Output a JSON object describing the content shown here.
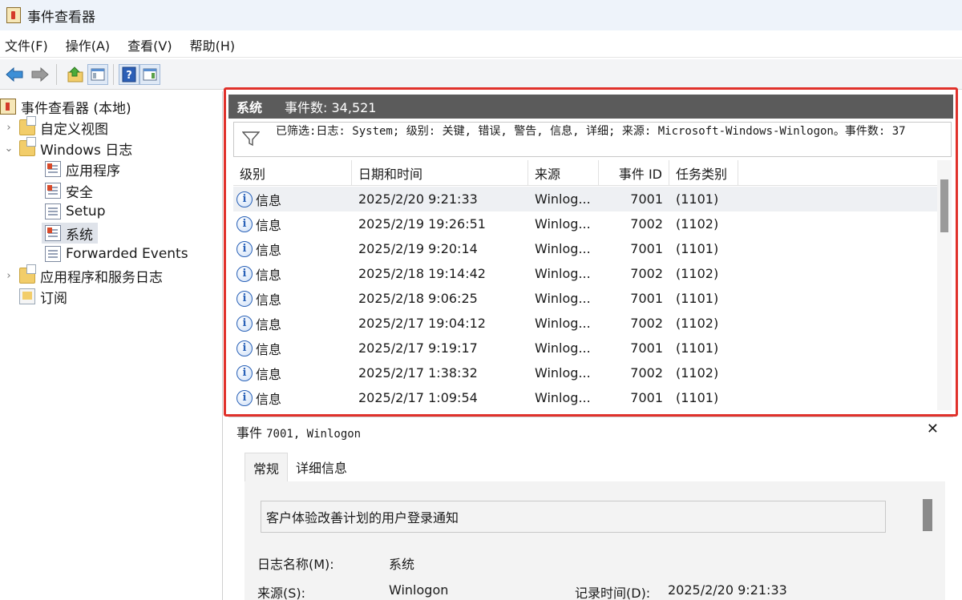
{
  "window": {
    "title": "事件查看器"
  },
  "menu": [
    {
      "label": "文件(F)"
    },
    {
      "label": "操作(A)"
    },
    {
      "label": "查看(V)"
    },
    {
      "label": "帮助(H)"
    }
  ],
  "toolbar": {
    "icons": [
      "back-arrow-icon",
      "forward-arrow-icon",
      "up-folder-icon",
      "show-hide-console-tree-icon",
      "help-icon",
      "show-hide-action-pane-icon"
    ]
  },
  "tree": {
    "root": "事件查看器 (本地)",
    "custom_views": "自定义视图",
    "windows_logs": "Windows 日志",
    "application": "应用程序",
    "security": "安全",
    "setup": "Setup",
    "system": "系统",
    "forwarded": "Forwarded Events",
    "app_service_logs": "应用程序和服务日志",
    "subscriptions": "订阅"
  },
  "list": {
    "log_name": "系统",
    "count_label": "事件数: 34,521",
    "filter_text": "已筛选:日志: System; 级别: 关键, 错误, 警告, 信息, 详细; 来源: Microsoft-Windows-Winlogon。事件数: 37",
    "columns": [
      "级别",
      "日期和时间",
      "来源",
      "事件 ID",
      "任务类别"
    ],
    "rows": [
      {
        "level": "信息",
        "datetime": "2025/2/20 9:21:33",
        "source": "Winlog...",
        "id": "7001",
        "task": "(1101)"
      },
      {
        "level": "信息",
        "datetime": "2025/2/19 19:26:51",
        "source": "Winlog...",
        "id": "7002",
        "task": "(1102)"
      },
      {
        "level": "信息",
        "datetime": "2025/2/19 9:20:14",
        "source": "Winlog...",
        "id": "7001",
        "task": "(1101)"
      },
      {
        "level": "信息",
        "datetime": "2025/2/18 19:14:42",
        "source": "Winlog...",
        "id": "7002",
        "task": "(1102)"
      },
      {
        "level": "信息",
        "datetime": "2025/2/18 9:06:25",
        "source": "Winlog...",
        "id": "7001",
        "task": "(1101)"
      },
      {
        "level": "信息",
        "datetime": "2025/2/17 19:04:12",
        "source": "Winlog...",
        "id": "7002",
        "task": "(1102)"
      },
      {
        "level": "信息",
        "datetime": "2025/2/17 9:19:17",
        "source": "Winlog...",
        "id": "7001",
        "task": "(1101)"
      },
      {
        "level": "信息",
        "datetime": "2025/2/17 1:38:32",
        "source": "Winlog...",
        "id": "7002",
        "task": "(1102)"
      },
      {
        "level": "信息",
        "datetime": "2025/2/17 1:09:54",
        "source": "Winlog...",
        "id": "7001",
        "task": "(1101)"
      }
    ]
  },
  "detail": {
    "title_prefix": "事件",
    "title_event": "7001, Winlogon",
    "close": "✕",
    "tabs": [
      "常规",
      "详细信息"
    ],
    "description": "客户体验改善计划的用户登录通知",
    "log_name_label": "日志名称(M):",
    "log_name_value": "系统",
    "source_label": "来源(S):",
    "source_value": "Winlogon",
    "logged_label": "记录时间(D):",
    "logged_value": "2025/2/20 9:21:33"
  },
  "colors": {
    "accent_red": "#e0312b",
    "header_gray": "#5b5b5b",
    "info_blue": "#2a62b8"
  }
}
